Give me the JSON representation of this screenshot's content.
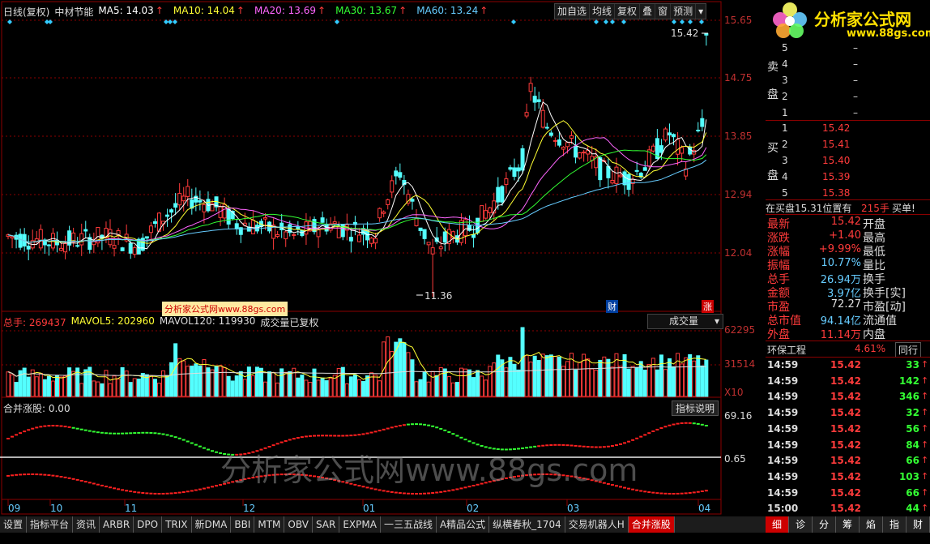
{
  "header": {
    "period": "日线(复权)",
    "stock_name": "中材节能",
    "ma": [
      {
        "label": "MA5: 14.03",
        "color": "#ffffff"
      },
      {
        "label": "MA10: 14.04",
        "color": "#ffff33"
      },
      {
        "label": "MA20: 13.69",
        "color": "#ff66ff"
      },
      {
        "label": "MA30: 13.67",
        "color": "#33ff33"
      },
      {
        "label": "MA60: 13.24",
        "color": "#66ccff"
      }
    ],
    "arrow": "↑"
  },
  "toolbar": [
    "加自选",
    "均线",
    "复权",
    "叠",
    "窗",
    "预测"
  ],
  "price_axis": [
    "15.65",
    "14.75",
    "13.85",
    "12.94",
    "12.04"
  ],
  "price_marks": {
    "high": "15.42",
    "low": "11.36"
  },
  "watermark_small": "分析家公式网www.88gs.com",
  "badges": {
    "fin": "财",
    "zhang": "涨"
  },
  "vol_header": {
    "total": "总手: 269437",
    "mavol5": "MAVOL5: 202960",
    "mavol120": "MAVOL120: 119930",
    "note": "成交量已复权",
    "select": "成交量"
  },
  "vol_axis": [
    "62295",
    "31514",
    "X10"
  ],
  "ind_header": {
    "name": "合并涨股: 0.00",
    "help": "指标说明"
  },
  "ind_axis": [
    "69.16",
    "0.65"
  ],
  "watermark_big": "分析家公式网www.88gs.com",
  "date_axis": [
    "09",
    "10",
    "11",
    "12",
    "01",
    "02",
    "03",
    "04"
  ],
  "bottom_tabs": [
    "设置",
    "指标平台",
    "资讯",
    "ARBR",
    "DPO",
    "TRIX",
    "新DMA",
    "BBI",
    "MTM",
    "OBV",
    "SAR",
    "EXPMA",
    "一三五战线",
    "A精品公式",
    "纵横春秋_1704",
    "交易机器人H",
    "合并涨股"
  ],
  "logo": {
    "text": "分析家公式网",
    "url": "www.88gs.com"
  },
  "sell": {
    "label1": "卖",
    "label2": "盘",
    "rows": [
      {
        "n": "5",
        "p": "–"
      },
      {
        "n": "4",
        "p": "–"
      },
      {
        "n": "3",
        "p": "–"
      },
      {
        "n": "2",
        "p": "–"
      },
      {
        "n": "1",
        "p": "–"
      }
    ]
  },
  "buy": {
    "label1": "买",
    "label2": "盘",
    "rows": [
      {
        "n": "1",
        "p": "15.42"
      },
      {
        "n": "2",
        "p": "15.41"
      },
      {
        "n": "3",
        "p": "15.40"
      },
      {
        "n": "4",
        "p": "15.39"
      },
      {
        "n": "5",
        "p": "15.38"
      }
    ]
  },
  "queue": {
    "text": "在买盘15.31位置有",
    "hands": "215手",
    "buy": "买单!"
  },
  "quote": [
    {
      "k": "最新",
      "v": "15.42",
      "k2": "开盘"
    },
    {
      "k": "涨跌",
      "v": "+1.40",
      "k2": "最高"
    },
    {
      "k": "涨幅",
      "v": "+9.99%",
      "k2": "最低"
    },
    {
      "k": "振幅",
      "v": "10.77%",
      "k2": "量比"
    },
    {
      "k": "总手",
      "v": "26.94万",
      "k2": "换手"
    },
    {
      "k": "金额",
      "v": "3.97亿",
      "k2": "换手[实]"
    },
    {
      "k": "市盈",
      "v": "72.27",
      "k2": "市盈[动]"
    },
    {
      "k": "总市值",
      "v": "94.14亿",
      "k2": "流通值"
    },
    {
      "k": "外盘",
      "v": "11.14万",
      "k2": "内盘"
    }
  ],
  "sector": {
    "name": "环保工程",
    "pct": "4.61%",
    "btn": "同行"
  },
  "ticks": [
    {
      "t": "14:59",
      "p": "15.42",
      "v": "33"
    },
    {
      "t": "14:59",
      "p": "15.42",
      "v": "142"
    },
    {
      "t": "14:59",
      "p": "15.42",
      "v": "346"
    },
    {
      "t": "14:59",
      "p": "15.42",
      "v": "32"
    },
    {
      "t": "14:59",
      "p": "15.42",
      "v": "56"
    },
    {
      "t": "14:59",
      "p": "15.42",
      "v": "84"
    },
    {
      "t": "14:59",
      "p": "15.42",
      "v": "66"
    },
    {
      "t": "14:59",
      "p": "15.42",
      "v": "103"
    },
    {
      "t": "14:59",
      "p": "15.42",
      "v": "66"
    },
    {
      "t": "15:00",
      "p": "15.42",
      "v": "44"
    }
  ],
  "right_tabs": [
    "细",
    "诊",
    "分",
    "筹",
    "焰",
    "指",
    "财"
  ],
  "colors": {
    "up": "#ff3b3b",
    "down": "#54ffff",
    "grid": "#8b0000"
  }
}
